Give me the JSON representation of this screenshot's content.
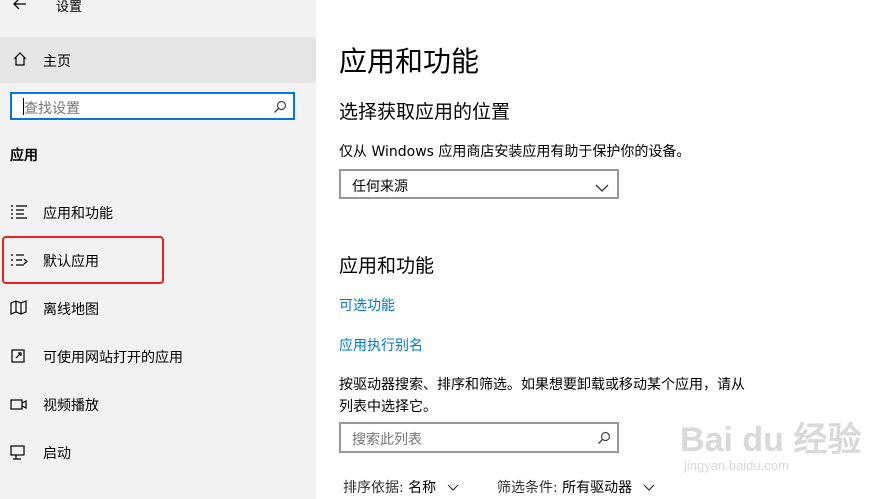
{
  "window": {
    "title": "设置"
  },
  "sidebar": {
    "home_label": "主页",
    "search_placeholder": "查找设置",
    "section_label": "应用",
    "items": [
      {
        "label": "应用和功能",
        "icon": "apps-list-icon"
      },
      {
        "label": "默认应用",
        "icon": "default-apps-icon"
      },
      {
        "label": "离线地图",
        "icon": "map-icon"
      },
      {
        "label": "可使用网站打开的应用",
        "icon": "website-app-icon"
      },
      {
        "label": "视频播放",
        "icon": "video-icon"
      },
      {
        "label": "启动",
        "icon": "startup-icon"
      }
    ],
    "highlight_color": "#e32525"
  },
  "main": {
    "title": "应用和功能",
    "install_section": {
      "heading": "选择获取应用的位置",
      "description": "仅从 Windows 应用商店安装应用有助于保护你的设备。",
      "dropdown_value": "任何来源"
    },
    "apps_section": {
      "heading": "应用和功能",
      "link_optional": "可选功能",
      "link_alias": "应用执行别名",
      "description_line1": "按驱动器搜索、排序和筛选。如果想要卸载或移动某个应用，请从",
      "description_line2": "列表中选择它。",
      "search_placeholder": "搜索此列表",
      "sort_label": "排序依据:",
      "sort_value": "名称",
      "filter_label": "筛选条件:",
      "filter_value": "所有驱动器"
    }
  },
  "watermark": {
    "logo_text": "Bai du 经验",
    "url": "jingyan.baidu.com"
  },
  "colors": {
    "accent": "#0078d7",
    "sidebar_bg": "#f2f2f2",
    "selected_bg": "#e5e5e5"
  }
}
